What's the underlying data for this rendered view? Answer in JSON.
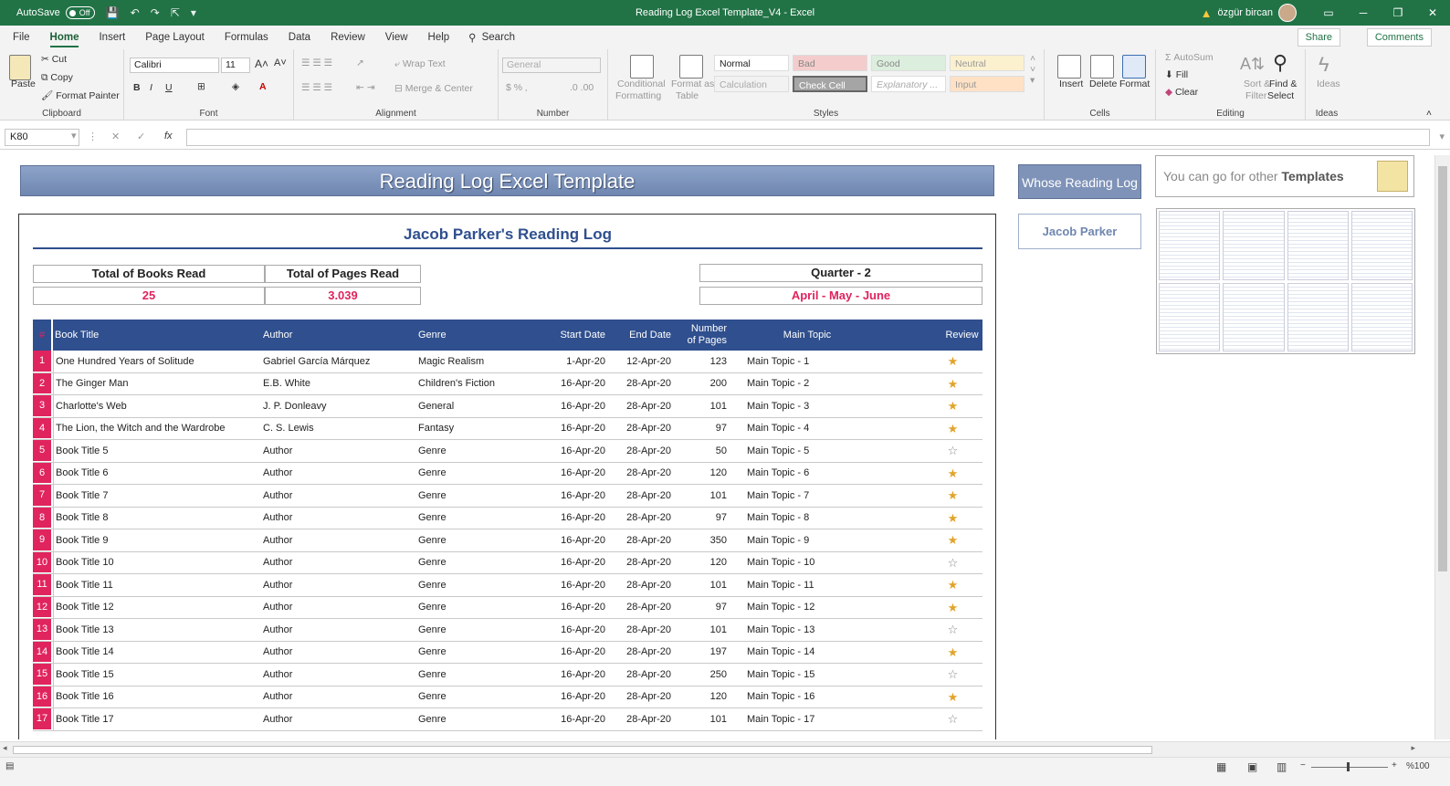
{
  "titlebar": {
    "autosave_label": "AutoSave",
    "autosave_state": "Off",
    "document_title": "Reading Log Excel Template_V4  -  Excel",
    "user_name": "özgür bircan"
  },
  "tabs": [
    "File",
    "Home",
    "Insert",
    "Page Layout",
    "Formulas",
    "Data",
    "Review",
    "View",
    "Help"
  ],
  "search_label": "Search",
  "share_label": "Share",
  "comments_label": "Comments",
  "ribbon": {
    "clipboard": {
      "paste": "Paste",
      "cut": "Cut",
      "copy": "Copy",
      "format_painter": "Format Painter",
      "label": "Clipboard"
    },
    "font": {
      "name": "Calibri",
      "size": "11",
      "label": "Font"
    },
    "alignment": {
      "wrap": "Wrap Text",
      "merge": "Merge & Center",
      "label": "Alignment"
    },
    "number": {
      "format": "General",
      "label": "Number"
    },
    "styles": {
      "conditional": "Conditional",
      "conditional2": "Formatting",
      "format_as": "Format as",
      "format_as2": "Table",
      "normal": "Normal",
      "bad": "Bad",
      "good": "Good",
      "neutral": "Neutral",
      "calculation": "Calculation",
      "check_cell": "Check Cell",
      "explanatory": "Explanatory ...",
      "input": "Input",
      "label": "Styles"
    },
    "cells": {
      "insert": "Insert",
      "delete": "Delete",
      "format": "Format",
      "label": "Cells"
    },
    "editing": {
      "autosum": "AutoSum",
      "fill": "Fill",
      "clear": "Clear",
      "sort": "Sort &",
      "sort2": "Filter",
      "find": "Find &",
      "find2": "Select",
      "label": "Editing"
    },
    "ideas": {
      "ideas": "Ideas",
      "label": "Ideas"
    }
  },
  "formula_bar": {
    "name_box": "K80",
    "formula": ""
  },
  "sheet": {
    "banner_title": "Reading Log Excel Template",
    "whose_button": "Whose Reading Log",
    "person_name": "Jacob Parker",
    "templates_text": "You can go for other ",
    "templates_bold": "Templates",
    "log_title": "Jacob Parker's Reading Log",
    "total_books_label": "Total of Books Read",
    "total_books_value": "25",
    "total_pages_label": "Total of Pages Read",
    "total_pages_value": "3.039",
    "quarter_label": "Quarter - 2",
    "quarter_months": "April - May - June"
  },
  "table": {
    "headers": {
      "num": "#",
      "title": "Book Title",
      "author": "Author",
      "genre": "Genre",
      "start": "Start Date",
      "end": "End Date",
      "pages1": "Number",
      "pages2": "of Pages",
      "topic": "Main Topic",
      "review": "Review"
    },
    "rows": [
      {
        "n": "1",
        "title": "One Hundred Years of Solitude",
        "author": "Gabriel García Márquez",
        "genre": "Magic Realism",
        "start": "1-Apr-20",
        "end": "12-Apr-20",
        "pages": "123",
        "topic": "Main Topic - 1",
        "starred": true
      },
      {
        "n": "2",
        "title": "The Ginger Man",
        "author": "E.B. White",
        "genre": "Children's Fiction",
        "start": "16-Apr-20",
        "end": "28-Apr-20",
        "pages": "200",
        "topic": "Main Topic - 2",
        "starred": true
      },
      {
        "n": "3",
        "title": "Charlotte's Web",
        "author": "J. P. Donleavy",
        "genre": "General",
        "start": "16-Apr-20",
        "end": "28-Apr-20",
        "pages": "101",
        "topic": "Main Topic - 3",
        "starred": true
      },
      {
        "n": "4",
        "title": "The Lion, the Witch and the Wardrobe",
        "author": "C. S. Lewis",
        "genre": "Fantasy",
        "start": "16-Apr-20",
        "end": "28-Apr-20",
        "pages": "97",
        "topic": "Main Topic - 4",
        "starred": true
      },
      {
        "n": "5",
        "title": "Book Title 5",
        "author": "Author",
        "genre": "Genre",
        "start": "16-Apr-20",
        "end": "28-Apr-20",
        "pages": "50",
        "topic": "Main Topic - 5",
        "starred": false
      },
      {
        "n": "6",
        "title": "Book Title 6",
        "author": "Author",
        "genre": "Genre",
        "start": "16-Apr-20",
        "end": "28-Apr-20",
        "pages": "120",
        "topic": "Main Topic - 6",
        "starred": true
      },
      {
        "n": "7",
        "title": "Book Title 7",
        "author": "Author",
        "genre": "Genre",
        "start": "16-Apr-20",
        "end": "28-Apr-20",
        "pages": "101",
        "topic": "Main Topic - 7",
        "starred": true
      },
      {
        "n": "8",
        "title": "Book Title 8",
        "author": "Author",
        "genre": "Genre",
        "start": "16-Apr-20",
        "end": "28-Apr-20",
        "pages": "97",
        "topic": "Main Topic - 8",
        "starred": true
      },
      {
        "n": "9",
        "title": "Book Title 9",
        "author": "Author",
        "genre": "Genre",
        "start": "16-Apr-20",
        "end": "28-Apr-20",
        "pages": "350",
        "topic": "Main Topic - 9",
        "starred": true
      },
      {
        "n": "10",
        "title": "Book Title 10",
        "author": "Author",
        "genre": "Genre",
        "start": "16-Apr-20",
        "end": "28-Apr-20",
        "pages": "120",
        "topic": "Main Topic - 10",
        "starred": false
      },
      {
        "n": "11",
        "title": "Book Title 11",
        "author": "Author",
        "genre": "Genre",
        "start": "16-Apr-20",
        "end": "28-Apr-20",
        "pages": "101",
        "topic": "Main Topic - 11",
        "starred": true
      },
      {
        "n": "12",
        "title": "Book Title 12",
        "author": "Author",
        "genre": "Genre",
        "start": "16-Apr-20",
        "end": "28-Apr-20",
        "pages": "97",
        "topic": "Main Topic - 12",
        "starred": true
      },
      {
        "n": "13",
        "title": "Book Title 13",
        "author": "Author",
        "genre": "Genre",
        "start": "16-Apr-20",
        "end": "28-Apr-20",
        "pages": "101",
        "topic": "Main Topic - 13",
        "starred": false
      },
      {
        "n": "14",
        "title": "Book Title 14",
        "author": "Author",
        "genre": "Genre",
        "start": "16-Apr-20",
        "end": "28-Apr-20",
        "pages": "197",
        "topic": "Main Topic - 14",
        "starred": true
      },
      {
        "n": "15",
        "title": "Book Title 15",
        "author": "Author",
        "genre": "Genre",
        "start": "16-Apr-20",
        "end": "28-Apr-20",
        "pages": "250",
        "topic": "Main Topic - 15",
        "starred": false
      },
      {
        "n": "16",
        "title": "Book Title 16",
        "author": "Author",
        "genre": "Genre",
        "start": "16-Apr-20",
        "end": "28-Apr-20",
        "pages": "120",
        "topic": "Main Topic - 16",
        "starred": true
      },
      {
        "n": "17",
        "title": "Book Title 17",
        "author": "Author",
        "genre": "Genre",
        "start": "16-Apr-20",
        "end": "28-Apr-20",
        "pages": "101",
        "topic": "Main Topic - 17",
        "starred": false
      }
    ]
  },
  "status": {
    "zoom": "%100"
  },
  "icons": {
    "star_filled": "star-icon",
    "star_empty": "star-outline-icon",
    "accent": "#217346",
    "table_header": "#2f4f8e",
    "row_number": "#e0245e"
  }
}
